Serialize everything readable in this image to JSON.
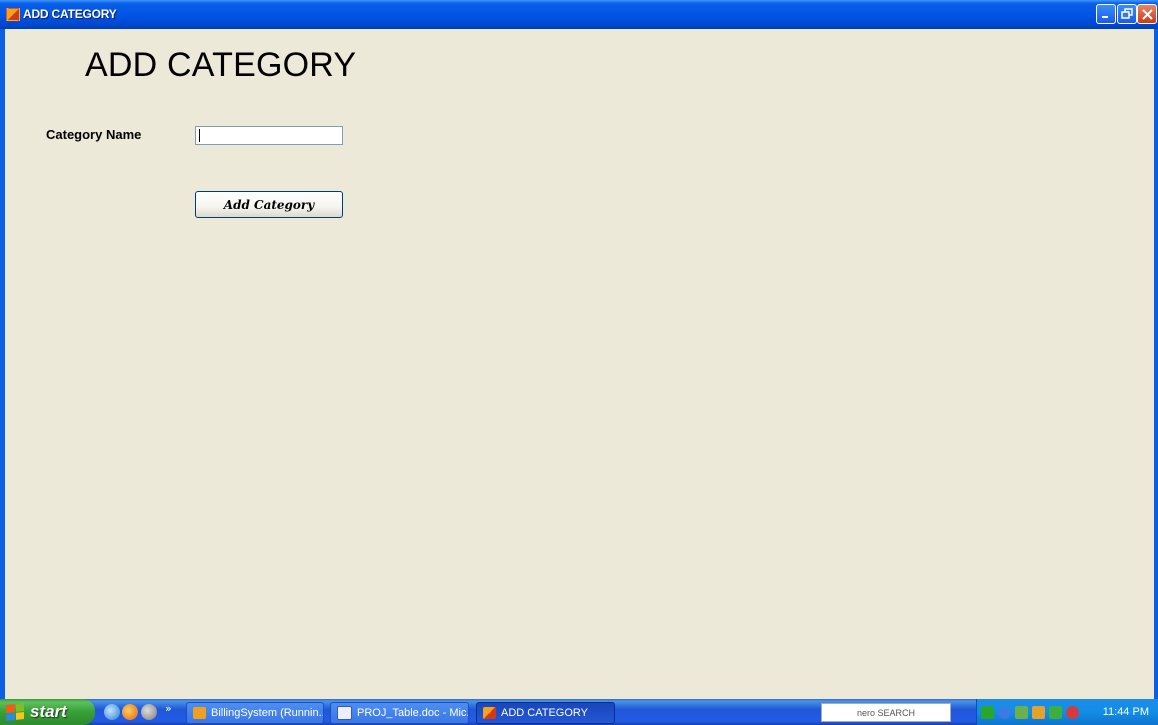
{
  "window": {
    "title": "ADD CATEGORY"
  },
  "form": {
    "heading": "ADD CATEGORY",
    "category_label": "Category Name",
    "category_value": "",
    "add_button_label": "Add Category"
  },
  "taskbar": {
    "start_label": "start",
    "tasks": [
      {
        "label": "BillingSystem (Runnin..."
      },
      {
        "label": "PROJ_Table.doc - Mic..."
      },
      {
        "label": "ADD CATEGORY"
      }
    ],
    "nero_label": "nero SEARCH",
    "clock": "11:44 PM"
  }
}
